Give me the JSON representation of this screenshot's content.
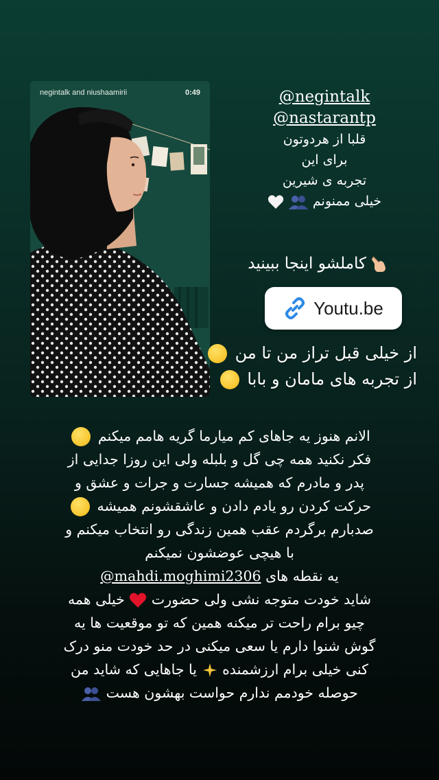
{
  "video": {
    "header_left": "negintalk and niushaamirii",
    "duration": "0:49"
  },
  "mentions": {
    "first": "@negintalk",
    "second": "@nastarantp",
    "thanks_lines": [
      "قلبا از هردوتون",
      "برای این",
      "تجربه ی شیرین",
      "خیلی ممنونم"
    ]
  },
  "watch_line": "کاملشو اینجا ببینید",
  "link_sticker": {
    "label": "Youtu.be"
  },
  "overlay_lines": [
    "از خیلی قبل تراز من تا من",
    "از تجربه های مامان و بابا"
  ],
  "paragraph_lines": [
    "الانم هنوز یه جاهای کم میارما گریه هامم میکنم",
    "فکر نکنید همه چی گل و بلبله ولی این روزا جدایی از",
    "پدر و مادرم که همیشه جسارت و جرات و عشق و",
    "حرکت کردن رو یادم دادن و عاشقشونم همیشه",
    "صدبارم برگردم عقب همین زندگی رو انتخاب میکنم و",
    "با هیچی عوضشون نمیکنم",
    "یه نقطه های",
    "@mahdi.moghimi2306",
    "شاید خودت متوجه نشی ولی حضورت",
    "خیلی همه",
    "چیو برام راحت تر میکنه همین که تو موقعیت ها یه",
    "گوش شنوا دارم یا سعی میکنی در حد خودت منو درک",
    "کنی خیلی برام ارزشمنده",
    "یا جاهایی که شاید من",
    "حوصله خودمم ندارم حواست بهشون هست"
  ],
  "colors": {
    "bg_top": "#0b3d33",
    "bg_bottom": "#030807",
    "heart": "#e3132b",
    "link_icon": "#2e8ae6"
  },
  "icons": [
    "link-icon",
    "pointing-hand-icon",
    "white-heart-icon",
    "red-heart-icon",
    "sparkles-icon",
    "people-icon",
    "grinning-face-icon",
    "pleading-face-icon"
  ]
}
